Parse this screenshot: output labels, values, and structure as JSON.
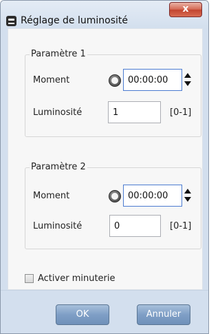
{
  "window": {
    "title": "Réglage de luminosité",
    "close_label": "x"
  },
  "groups": [
    {
      "legend": "Paramètre 1",
      "moment_label": "Moment",
      "time_value": "00:00:00",
      "luminosity_label": "Luminosité",
      "luminosity_value": "1",
      "range_label": "[0-1]"
    },
    {
      "legend": "Paramètre 2",
      "moment_label": "Moment",
      "time_value": "00:00:00",
      "luminosity_label": "Luminosité",
      "luminosity_value": "0",
      "range_label": "[0-1]"
    }
  ],
  "timer": {
    "checkbox_label": "Activer minuterie",
    "checked": false
  },
  "buttons": {
    "ok_label": "OK",
    "cancel_label": "Annuler"
  }
}
